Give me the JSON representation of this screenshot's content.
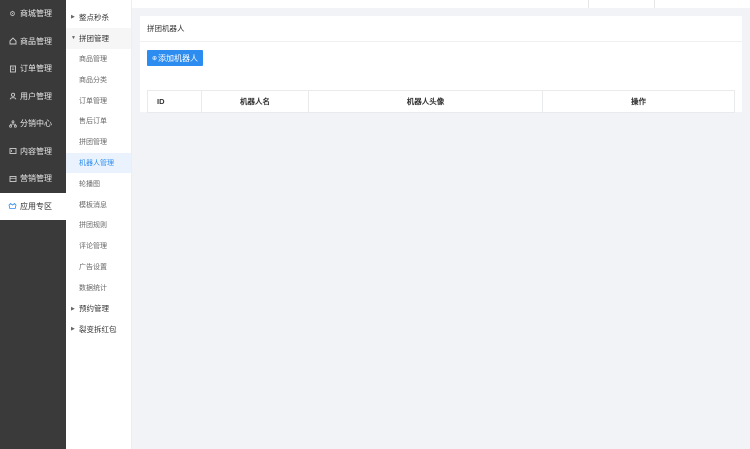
{
  "nav": {
    "items": [
      {
        "label": "商城管理",
        "icon": "settings-icon",
        "active": false
      },
      {
        "label": "商品管理",
        "icon": "home-icon",
        "active": false
      },
      {
        "label": "订单管理",
        "icon": "clipboard-icon",
        "active": false
      },
      {
        "label": "用户管理",
        "icon": "user-icon",
        "active": false
      },
      {
        "label": "分销中心",
        "icon": "network-icon",
        "active": false
      },
      {
        "label": "内容管理",
        "icon": "content-icon",
        "active": false
      },
      {
        "label": "营销管理",
        "icon": "marketing-icon",
        "active": false
      },
      {
        "label": "应用专区",
        "icon": "app-icon",
        "active": true
      }
    ]
  },
  "submenu": {
    "items": [
      {
        "label": "整点秒杀",
        "type": "group",
        "state": "collapsed"
      },
      {
        "label": "拼团管理",
        "type": "group",
        "state": "expanded"
      },
      {
        "label": "商品管理",
        "type": "child"
      },
      {
        "label": "商品分类",
        "type": "child"
      },
      {
        "label": "订单管理",
        "type": "child"
      },
      {
        "label": "售后订单",
        "type": "child"
      },
      {
        "label": "拼团管理",
        "type": "child"
      },
      {
        "label": "机器人管理",
        "type": "child",
        "selected": true
      },
      {
        "label": "轮播图",
        "type": "child"
      },
      {
        "label": "模板消息",
        "type": "child"
      },
      {
        "label": "拼团规则",
        "type": "child"
      },
      {
        "label": "评论管理",
        "type": "child"
      },
      {
        "label": "广告设置",
        "type": "child"
      },
      {
        "label": "数据统计",
        "type": "child"
      },
      {
        "label": "预约管理",
        "type": "group",
        "state": "collapsed"
      },
      {
        "label": "裂变拆红包",
        "type": "group",
        "state": "collapsed"
      }
    ]
  },
  "main": {
    "title": "拼团机器人",
    "add_button": "添加机器人",
    "table": {
      "columns": [
        "ID",
        "机器人名",
        "机器人头像",
        "操作"
      ]
    }
  },
  "colors": {
    "primary": "#2d8cf0",
    "nav_bg": "#3a3a3a",
    "page_bg": "#f2f3f7"
  }
}
